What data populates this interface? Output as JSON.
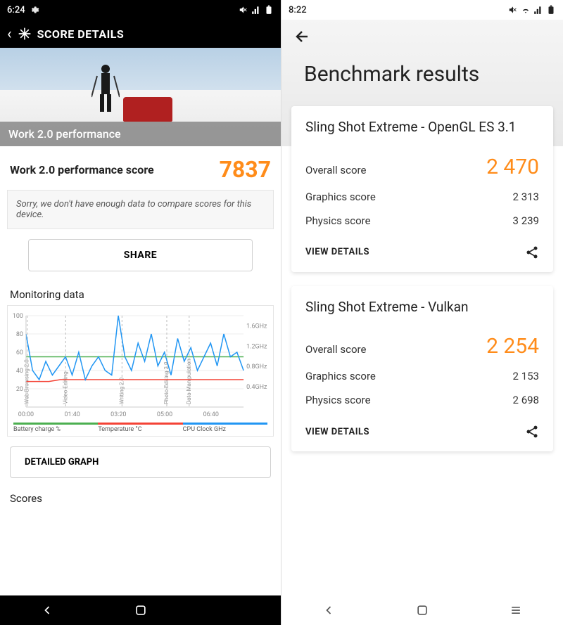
{
  "left": {
    "status": {
      "time": "6:24"
    },
    "header": {
      "title": "SCORE DETAILS"
    },
    "hero": {
      "banner": "Work 2.0 performance"
    },
    "score": {
      "label": "Work 2.0 performance score",
      "value": "7837"
    },
    "note": "Sorry, we don't have enough data to compare scores for this device.",
    "share": "SHARE",
    "monitoring_title": "Monitoring data",
    "detailed_btn": "DETAILED GRAPH",
    "scores_title": "Scores",
    "legend": {
      "battery": "Battery charge %",
      "temp": "Temperature °C",
      "cpu": "CPU Clock GHz"
    }
  },
  "right": {
    "status": {
      "time": "8:22"
    },
    "title": "Benchmark results",
    "cards": [
      {
        "title": "Sling Shot Extreme - OpenGL ES 3.1",
        "overall_label": "Overall score",
        "overall_value": "2 470",
        "graphics_label": "Graphics score",
        "graphics_value": "2 313",
        "physics_label": "Physics score",
        "physics_value": "3 239",
        "view": "VIEW DETAILS"
      },
      {
        "title": "Sling Shot Extreme - Vulkan",
        "overall_label": "Overall score",
        "overall_value": "2 254",
        "graphics_label": "Graphics score",
        "graphics_value": "2 153",
        "physics_label": "Physics score",
        "physics_value": "2 698",
        "view": "VIEW DETAILS"
      }
    ]
  },
  "chart_data": {
    "type": "line",
    "title": "Monitoring data",
    "x_ticks": [
      "00:00",
      "01:40",
      "03:20",
      "05:00",
      "06:40"
    ],
    "y_left_ticks": [
      20,
      40,
      60,
      80,
      100
    ],
    "y_right_ticks": [
      "0.4GHz",
      "0.8GHz",
      "1.2GHz",
      "1.6GHz"
    ],
    "phases": [
      "Web Browsing 2.0",
      "Video Editing",
      "Writing 2.0",
      "Photo Editing 2.0",
      "Data Manipulation"
    ],
    "phase_x": [
      2,
      62,
      150,
      220,
      255
    ],
    "series": [
      {
        "name": "Battery charge %",
        "color": "#4caf50",
        "values": [
          55,
          55,
          55,
          55,
          55,
          55,
          55,
          55,
          55,
          55,
          55,
          55,
          55,
          55,
          55,
          55,
          55,
          55,
          55,
          55
        ]
      },
      {
        "name": "Temperature °C",
        "color": "#f44336",
        "values": [
          28,
          28,
          28,
          30,
          30,
          30,
          30,
          30,
          30,
          30,
          30,
          30,
          30,
          30,
          30,
          30,
          30,
          30,
          30,
          30
        ]
      },
      {
        "name": "CPU Clock GHz",
        "color": "#2196f3",
        "values": [
          80,
          40,
          30,
          50,
          35,
          45,
          55,
          35,
          60,
          30,
          45,
          55,
          40,
          35,
          100,
          55,
          40,
          70,
          50,
          80,
          45,
          60,
          35,
          75,
          50,
          65,
          40,
          55,
          70,
          45,
          80,
          55,
          60,
          40
        ]
      }
    ]
  }
}
